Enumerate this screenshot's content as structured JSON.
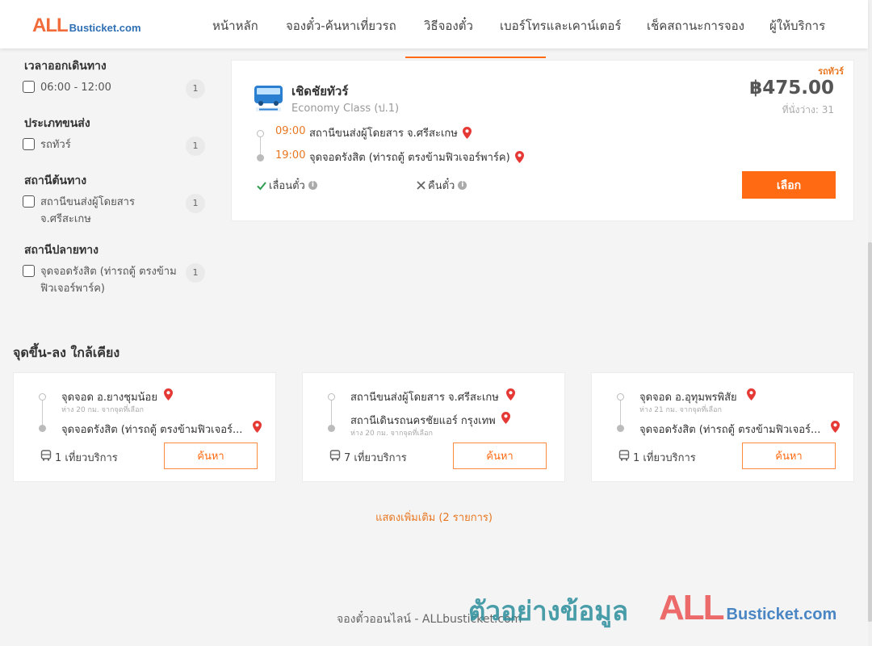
{
  "brand": {
    "logo_all": "ALL",
    "logo_rest": "Busticket.com"
  },
  "nav": [
    {
      "label": "หน้าหลัก"
    },
    {
      "label": "จองตั๋ว-ค้นหาเที่ยวรถ"
    },
    {
      "label": "วิธีจองตั๋ว"
    },
    {
      "label": "เบอร์โทรและเคาน์เตอร์"
    },
    {
      "label": "เช็คสถานะการจอง"
    },
    {
      "label": "ผู้ให้บริการ"
    }
  ],
  "filters": [
    {
      "title": "เวลาออกเดินทาง",
      "options": [
        {
          "label": "06:00 - 12:00",
          "count": "1"
        }
      ]
    },
    {
      "title": "ประเภทขนส่ง",
      "options": [
        {
          "label": "รถทัวร์",
          "count": "1"
        }
      ]
    },
    {
      "title": "สถานีต้นทาง",
      "options": [
        {
          "label": "สถานีขนส่งผู้โดยสาร จ.ศรีสะเกษ",
          "count": "1"
        }
      ]
    },
    {
      "title": "สถานีปลายทาง",
      "options": [
        {
          "label": "จุดจอดรังสิต (ท่ารถตู้ ตรงข้ามฟิวเจอร์พาร์ค)",
          "count": "1"
        }
      ]
    }
  ],
  "trip": {
    "type_tag": "รถทัวร์",
    "operator": "เชิดชัยทัวร์",
    "class": "Economy Class (ป.1)",
    "price": "฿475.00",
    "seats": "ที่นั่งว่าง: 31",
    "depart_time": "09:00",
    "depart_stop": "สถานีขนส่งผู้โดยสาร จ.ศรีสะเกษ",
    "arrive_time": "19:00",
    "arrive_stop": "จุดจอดรังสิต (ท่ารถตู้ ตรงข้ามฟิวเจอร์พาร์ค)",
    "policy_postpone": "เลื่อนตั๋ว",
    "policy_refund": "คืนตั๋ว",
    "select_label": "เลือก"
  },
  "nearby": {
    "title": "จุดขึ้น-ลง ใกล้เคียง",
    "cards": [
      {
        "from": "จุดจอด อ.ยางชุมน้อย",
        "from_dist": "ห่าง 20 กม. จากจุดที่เลือก",
        "to": "จุดจอดรังสิต (ท่ารถตู้ ตรงข้ามฟิวเจอร์...",
        "to_dist": "",
        "trips": "1 เที่ยวบริการ",
        "button": "ค้นหา"
      },
      {
        "from": "สถานีขนส่งผู้โดยสาร จ.ศรีสะเกษ",
        "from_dist": "",
        "to": "สถานีเดินรถนครชัยแอร์ กรุงเทพ",
        "to_dist": "ห่าง 20 กม. จากจุดที่เลือก",
        "trips": "7 เที่ยวบริการ",
        "button": "ค้นหา"
      },
      {
        "from": "จุดจอด อ.อุทุมพรพิสัย",
        "from_dist": "ห่าง 21 กม. จากจุดที่เลือก",
        "to": "จุดจอดรังสิต (ท่ารถตู้ ตรงข้ามฟิวเจอร์...",
        "to_dist": "",
        "trips": "1 เที่ยวบริการ",
        "button": "ค้นหา"
      }
    ],
    "show_more": "แสดงเพิ่มเติม (2 รายการ)"
  },
  "footer": {
    "text": "จองตั๋วออนไลน์ - ALLbusticket.com",
    "watermark_text": "ตัวอย่างข้อมูล",
    "watermark_logo_all": "ALL",
    "watermark_logo_rest": "Busticket.com"
  },
  "colors": {
    "accent": "#ff6a13",
    "pin": "#e53935",
    "check": "#2e9e4f"
  },
  "icons": {
    "pin": "map-pin-icon",
    "check": "check-icon",
    "cross": "cross-icon",
    "info": "info-icon",
    "bus": "bus-icon"
  }
}
